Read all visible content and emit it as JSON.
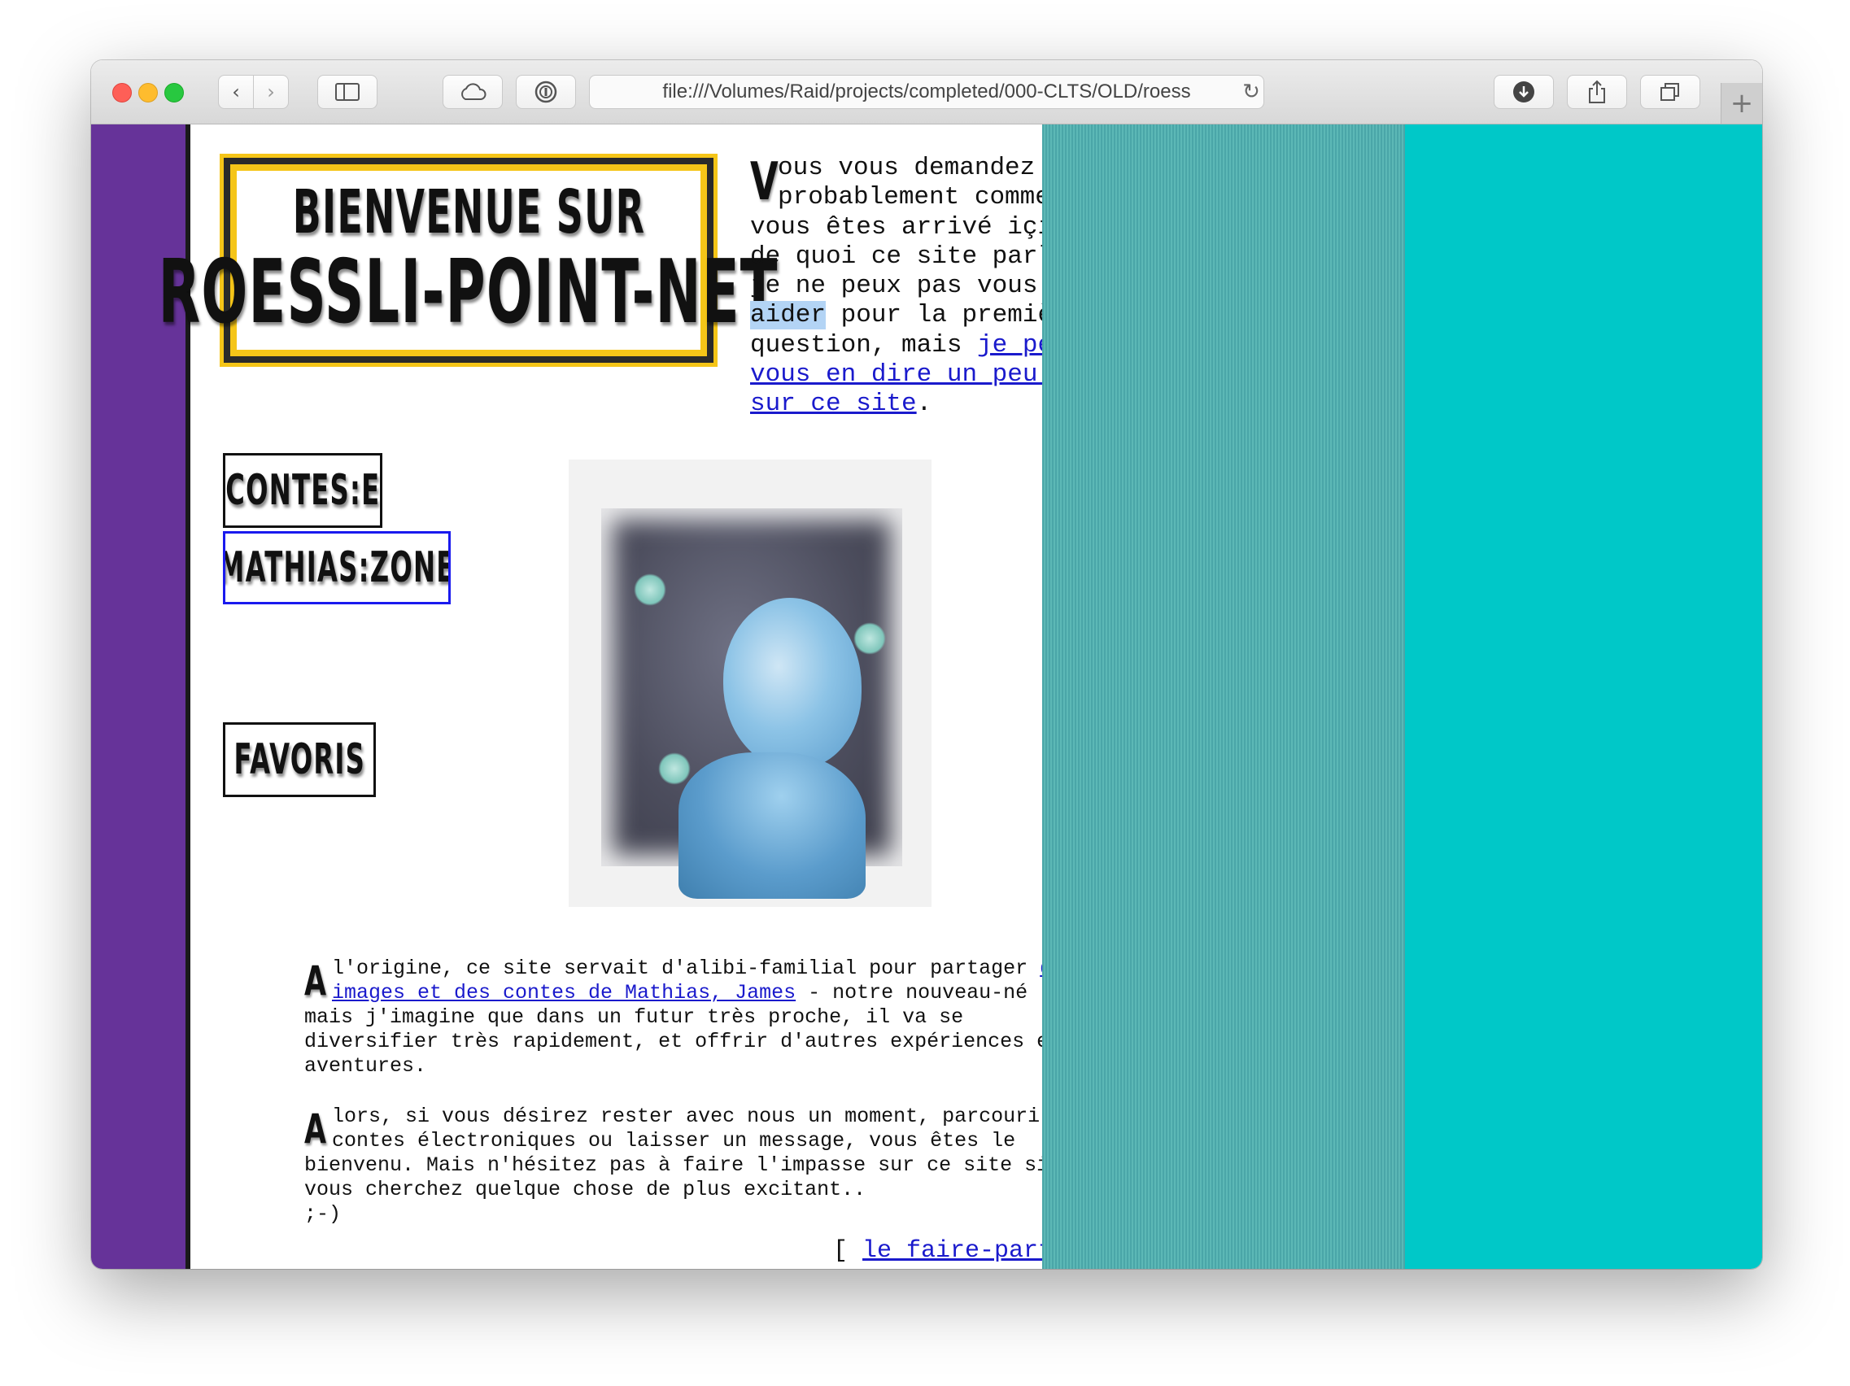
{
  "browser": {
    "url": "file:///Volumes/Raid/projects/completed/000-CLTS/OLD/roess",
    "plus": "+"
  },
  "page": {
    "banner": {
      "line1": "BIENVENUE SUR",
      "line2": "ROESSLI-POINT-NET"
    },
    "nav": {
      "contes": "CONTES:E",
      "mathias": "MATHIAS:ZONE",
      "favoris": "FAVORIS"
    },
    "intro": {
      "dropcap": "V",
      "text_before": "ous vous demandez probablement comment vous êtes arrivé içi, et de quoi ce site parle.. je ne peux pas vous ",
      "highlight": "aider",
      "text_after": " pour la première question, mais ",
      "link": "je peux vous en dire un peu plus sur ce site",
      "end": "."
    },
    "para1": {
      "dropcap": "A",
      "text_before": "l'origine, ce site servait d'alibi-familial pour partager ",
      "link": "des images et des contes de Mathias, James",
      "text_after": " - notre nouveau-né - mais j'imagine que dans un futur très proche, il va se diversifier très rapidement, et offrir d'autres expériences et aventures."
    },
    "para2": {
      "dropcap": "A",
      "text": "lors, si vous désirez rester avec nous un moment, parcourir nos contes électroniques ou laisser un message, vous êtes le bienvenu. Mais n'hésitez pas à faire l'impasse sur ce site si vous cherchez quelque chose de plus excitant..",
      "smiley": ";-)"
    },
    "faire_part": {
      "open": "[ ",
      "link": "le faire-part",
      "close": " ]"
    }
  },
  "colors": {
    "sidebar": "#663399",
    "banner_border": "#f5c518",
    "right_panel": "#00c8c8",
    "link": "#1a1acc"
  }
}
